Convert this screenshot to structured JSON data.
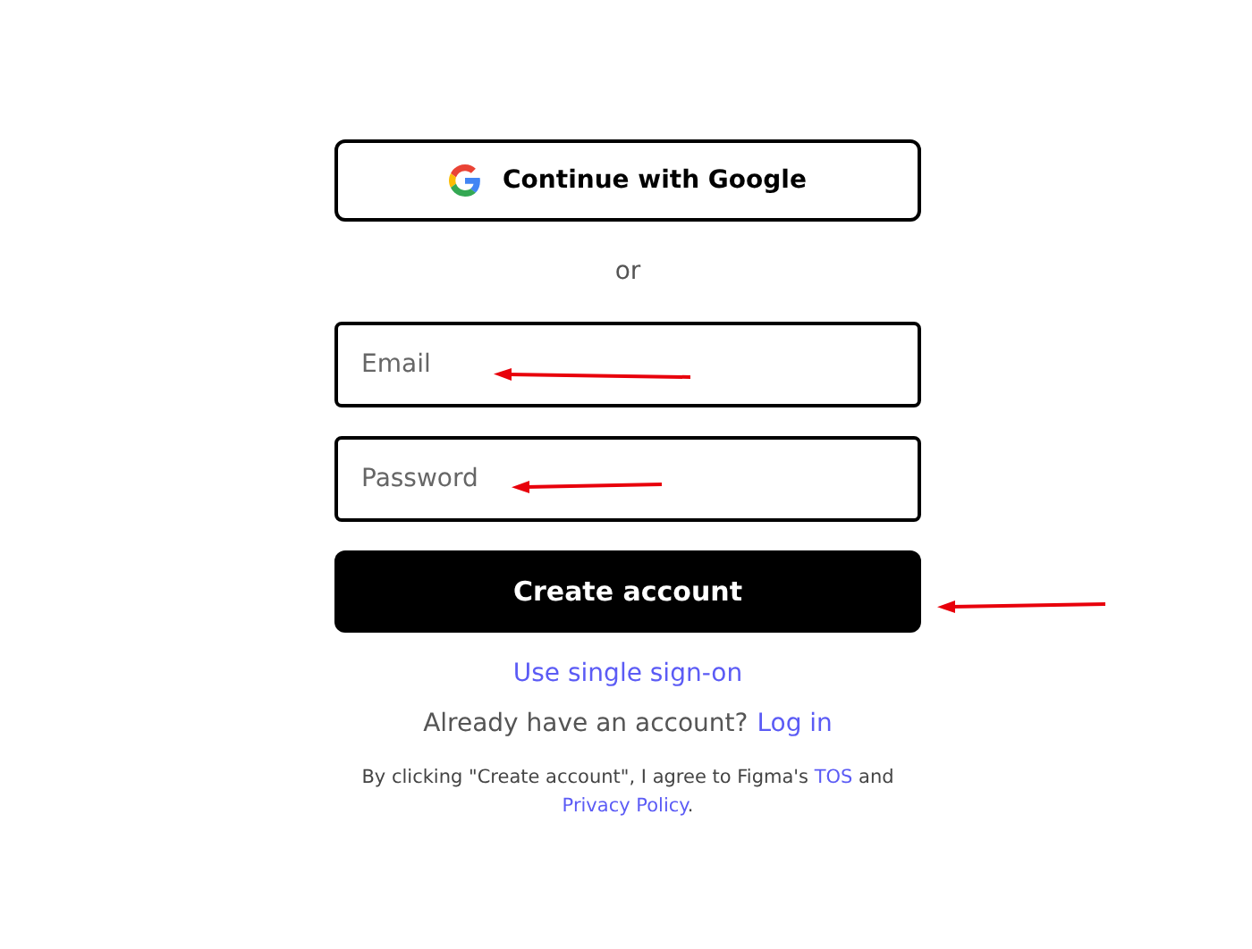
{
  "google_button": {
    "label": "Continue with Google"
  },
  "divider_text": "or",
  "email_field": {
    "placeholder": "Email"
  },
  "password_field": {
    "placeholder": "Password"
  },
  "create_button": {
    "label": "Create account"
  },
  "sso_link": "Use single sign-on",
  "login_prompt": {
    "text": "Already have an account?",
    "link": "Log in"
  },
  "terms": {
    "before": "By clicking \"Create account\", I agree to Figma's",
    "tos": "TOS",
    "middle": "and",
    "privacy": "Privacy Policy",
    "end": "."
  }
}
